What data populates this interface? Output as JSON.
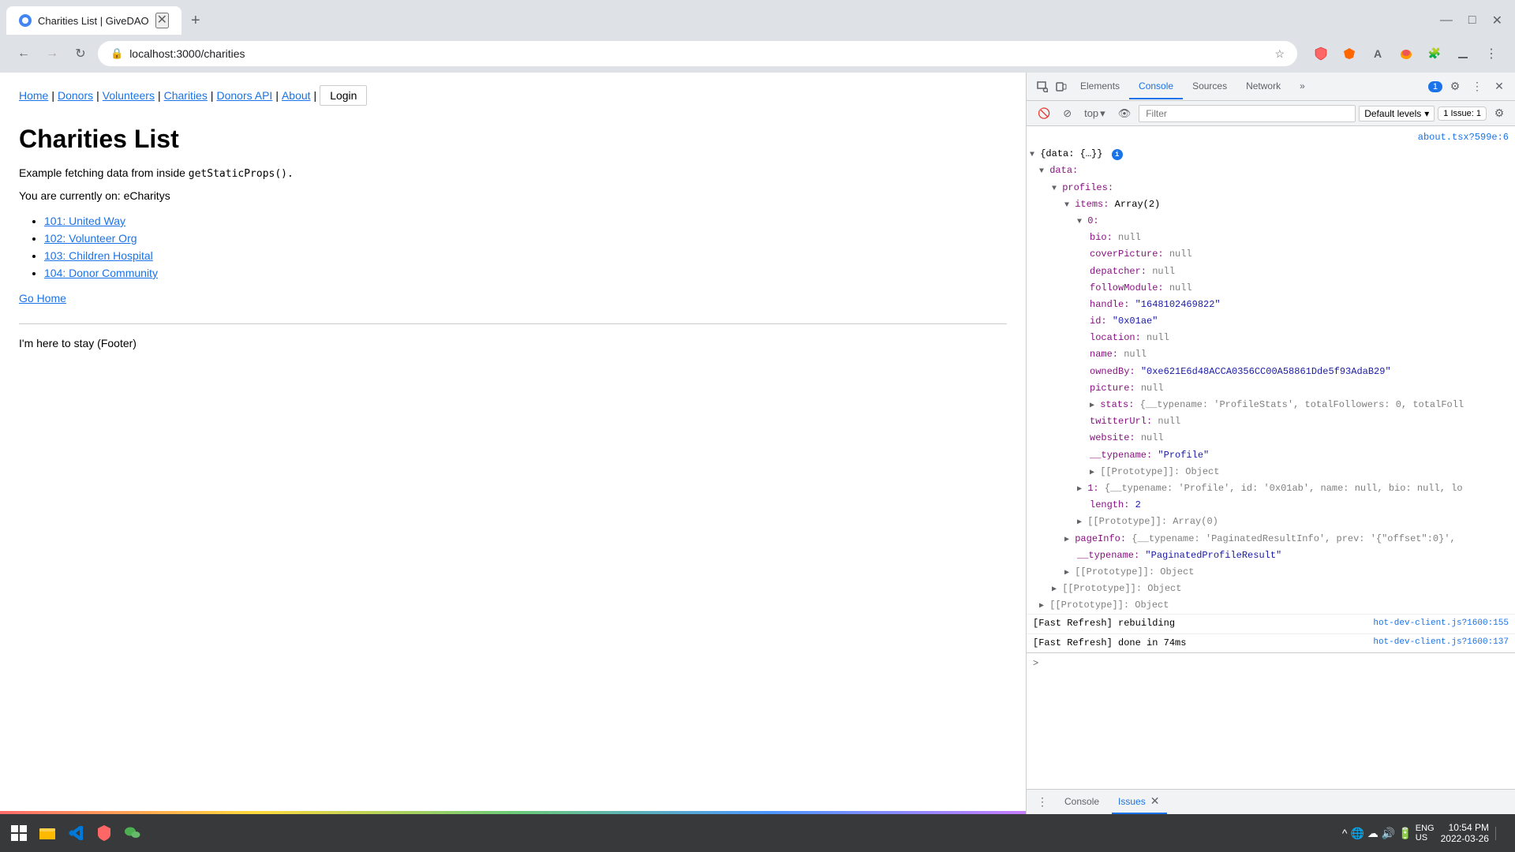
{
  "browser": {
    "tab_title": "Charities List | GiveDAO",
    "url": "localhost:3000/charities",
    "new_tab_label": "+",
    "back_disabled": false,
    "forward_disabled": true
  },
  "nav": {
    "links": [
      "Home",
      "Donors",
      "Volunteers",
      "Charities",
      "Donors API",
      "About"
    ],
    "login_label": "Login"
  },
  "page": {
    "title": "Charities List",
    "description_prefix": "Example fetching data from inside ",
    "description_code": "getStaticProps().",
    "current_label": "You are currently on: eCharitys",
    "charities": [
      {
        "id": "101",
        "name": "United Way",
        "href": "#"
      },
      {
        "id": "102",
        "name": "Volunteer Org",
        "href": "#"
      },
      {
        "id": "103",
        "name": "Children Hospital",
        "href": "#"
      },
      {
        "id": "104",
        "name": "Donor Community",
        "href": "#"
      }
    ],
    "go_home": "Go Home",
    "footer": "I'm here to stay (Footer)"
  },
  "devtools": {
    "tabs": [
      "Elements",
      "Console",
      "Sources",
      "Network"
    ],
    "active_tab": "Console",
    "toolbar": {
      "top_label": "top",
      "filter_placeholder": "Filter",
      "default_levels": "Default levels",
      "issue_count": "1 Issue: 1"
    },
    "console_lines": [
      {
        "type": "link",
        "text": "about.tsx?599e:6",
        "indent": 0
      },
      {
        "type": "tree",
        "text": "▼ {data: {…}}",
        "info": true,
        "indent": 0
      },
      {
        "type": "tree",
        "text": "▼ data:",
        "indent": 1
      },
      {
        "type": "tree",
        "text": "▼ profiles:",
        "indent": 2
      },
      {
        "type": "tree",
        "text": "▼ items: Array(2)",
        "indent": 3
      },
      {
        "type": "tree",
        "text": "▼ 0:",
        "indent": 4
      },
      {
        "type": "prop",
        "key": "bio:",
        "value": "null",
        "indent": 5
      },
      {
        "type": "prop",
        "key": "coverPicture:",
        "value": "null",
        "indent": 5
      },
      {
        "type": "prop",
        "key": "depatcher:",
        "value": "null",
        "indent": 5
      },
      {
        "type": "prop",
        "key": "followModule:",
        "value": "null",
        "indent": 5
      },
      {
        "type": "prop",
        "key": "handle:",
        "value": "\"1648102469822\"",
        "indent": 5
      },
      {
        "type": "prop",
        "key": "id:",
        "value": "\"0x01ae\"",
        "indent": 5
      },
      {
        "type": "prop",
        "key": "location:",
        "value": "null",
        "indent": 5
      },
      {
        "type": "prop",
        "key": "name:",
        "value": "null",
        "indent": 5
      },
      {
        "type": "prop",
        "key": "ownedBy:",
        "value": "\"0xe621E6d48ACCA0356CC00A58861Dde5f93AdaB29\"",
        "indent": 5
      },
      {
        "type": "prop",
        "key": "picture:",
        "value": "null",
        "indent": 5
      },
      {
        "type": "tree",
        "text": "▶ stats: {__typename: 'ProfileStats', totalFollowers: 0, totalFoll",
        "indent": 5
      },
      {
        "type": "prop",
        "key": "twitterUrl:",
        "value": "null",
        "indent": 5
      },
      {
        "type": "prop",
        "key": "website:",
        "value": "null",
        "indent": 5
      },
      {
        "type": "prop",
        "key": "__typename:",
        "value": "\"Profile\"",
        "indent": 5
      },
      {
        "type": "tree",
        "text": "▶ [[Prototype]]: Object",
        "indent": 5
      },
      {
        "type": "tree",
        "text": "▶ 1: {__typename: 'Profile', id: '0x01ab', name: null, bio: null, lo",
        "indent": 4
      },
      {
        "type": "prop",
        "key": "length:",
        "value": "2",
        "indent": 5
      },
      {
        "type": "tree",
        "text": "▶ [[Prototype]]: Array(0)",
        "indent": 4
      },
      {
        "type": "tree",
        "text": "▶ pageInfo: {__typename: 'PaginatedResultInfo', prev: '{\"offset\":0}',",
        "indent": 3
      },
      {
        "type": "prop",
        "key": "__typename:",
        "value": "\"PaginatedProfileResult\"",
        "indent": 4
      },
      {
        "type": "tree",
        "text": "▶ [[Prototype]]: Object",
        "indent": 3
      },
      {
        "type": "tree",
        "text": "▶ [[Prototype]]: Object",
        "indent": 2
      },
      {
        "type": "tree",
        "text": "▶ [[Prototype]]: Object",
        "indent": 1
      }
    ],
    "log_messages": [
      {
        "text": "[Fast Refresh] rebuilding",
        "link": "hot-dev-client.js?1600:155"
      },
      {
        "text": "[Fast Refresh] done in 74ms",
        "link": "hot-dev-client.js?1600:137"
      }
    ],
    "bottom_tabs": [
      "Console",
      "Issues"
    ],
    "issues_count": "x"
  },
  "taskbar": {
    "time": "10:54 PM",
    "date": "2022-03-26",
    "lang": "ENG",
    "region": "US"
  }
}
